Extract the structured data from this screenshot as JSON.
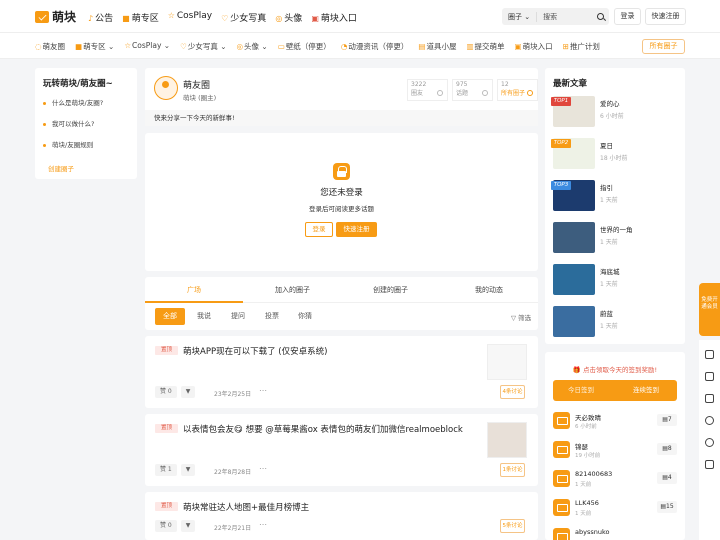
{
  "header": {
    "logo_text": "萌块",
    "nav": [
      {
        "icon": "bell-icon",
        "label": "公告"
      },
      {
        "icon": "zone-icon",
        "label": "萌专区"
      },
      {
        "icon": "star-icon",
        "label": "CosPlay"
      },
      {
        "icon": "heart-icon",
        "label": "少女写真"
      },
      {
        "icon": "circle-icon",
        "label": "头像"
      },
      {
        "icon": "grid-icon",
        "label": "萌块入口"
      }
    ],
    "search_category": "圈子 ⌄",
    "search_placeholder": "搜索",
    "login_label": "登录",
    "register_label": "快速注册"
  },
  "subnav": {
    "items": [
      "萌友圈",
      "萌专区 ⌄",
      "CosPlay ⌄",
      "少女写真 ⌄",
      "头像 ⌄",
      "壁纸（停更）",
      "动漫资讯（停更）",
      "道具小屋",
      "提交萌单",
      "萌块入口",
      "推广计划"
    ],
    "all_circles": "所有圈子"
  },
  "left_sidebar": {
    "title": "玩转萌块/萌友圈~",
    "items": [
      "什么是萌块/友圈?",
      "我可以做什么?",
      "萌块/友圈规则"
    ],
    "create_label": "创建圈子"
  },
  "circle": {
    "name": "萌友圈",
    "owner": "萌块 (圈主)",
    "stats": [
      {
        "value": "3222",
        "label": "圈友"
      },
      {
        "value": "975",
        "label": "话题"
      },
      {
        "value": "12",
        "label": "所有圈子"
      }
    ],
    "description": "快来分享一下今天的新鲜事!"
  },
  "login_prompt": {
    "title": "您还未登录",
    "subtitle": "登录后可阅读更多话题",
    "login_btn": "登录",
    "register_btn": "快速注册"
  },
  "tabs": {
    "main": [
      "广场",
      "加入的圈子",
      "创建的圈子",
      "我的动态"
    ],
    "filters": [
      "全部",
      "我说",
      "提问",
      "投票",
      "你猜"
    ],
    "filter_label": "筛选"
  },
  "posts": [
    {
      "badge": "置顶",
      "title": "萌块APP现在可以下载了 (仅安卓系统)",
      "likes": "赞 0",
      "date": "23年2月25日",
      "comments": "4条讨论"
    },
    {
      "badge": "置顶",
      "title": "以表情包会友😋 想要 @草莓果酱ox 表情包的萌友们加微信realmoeblock",
      "likes": "赞 1",
      "date": "22年8月28日",
      "comments": "1条讨论"
    },
    {
      "badge": "置顶",
      "title": "萌块常驻达人地图+最佳月榜博主",
      "likes": "赞 0",
      "date": "22年2月21日",
      "comments": "5条讨论"
    }
  ],
  "latest": {
    "title": "最新文章",
    "articles": [
      {
        "tag": "TOP1",
        "title": "爱的心",
        "time": "6 小时前",
        "color": "#e8e4da",
        "tagcolor": "#e0463c"
      },
      {
        "tag": "TOP2",
        "title": "夏日",
        "time": "18 小时前",
        "color": "#eef2e6",
        "tagcolor": "#f79b14"
      },
      {
        "tag": "TOP3",
        "title": "指引",
        "time": "1 天前",
        "color": "#1c3b6e",
        "tagcolor": "#3c8be0"
      },
      {
        "tag": "",
        "title": "世界的一角",
        "time": "1 天前",
        "color": "#3d5d7e",
        "tagcolor": ""
      },
      {
        "tag": "",
        "title": "海底城",
        "time": "1 天前",
        "color": "#2b6c9b",
        "tagcolor": ""
      },
      {
        "tag": "",
        "title": "蔚蓝",
        "time": "1 天前",
        "color": "#3a6da0",
        "tagcolor": ""
      }
    ]
  },
  "signin": {
    "prompt": "点击领取今天的签到奖励!",
    "today_rank": "今日签到",
    "streak_rank": "连续签到",
    "users": [
      {
        "name": "天必致晴",
        "time": "6 小时前",
        "count": "7"
      },
      {
        "name": "锦瑟",
        "time": "19 小时前",
        "count": "8"
      },
      {
        "name": "821400683",
        "time": "1 天前",
        "count": "4"
      },
      {
        "name": "LLK456",
        "time": "1 天前",
        "count": "15"
      },
      {
        "name": "abyssnuko",
        "time": "",
        "count": ""
      }
    ]
  },
  "float": {
    "label": "免费开通会员"
  },
  "colors": {
    "accent": "#f79b14",
    "top_badge": "#e05a47"
  }
}
